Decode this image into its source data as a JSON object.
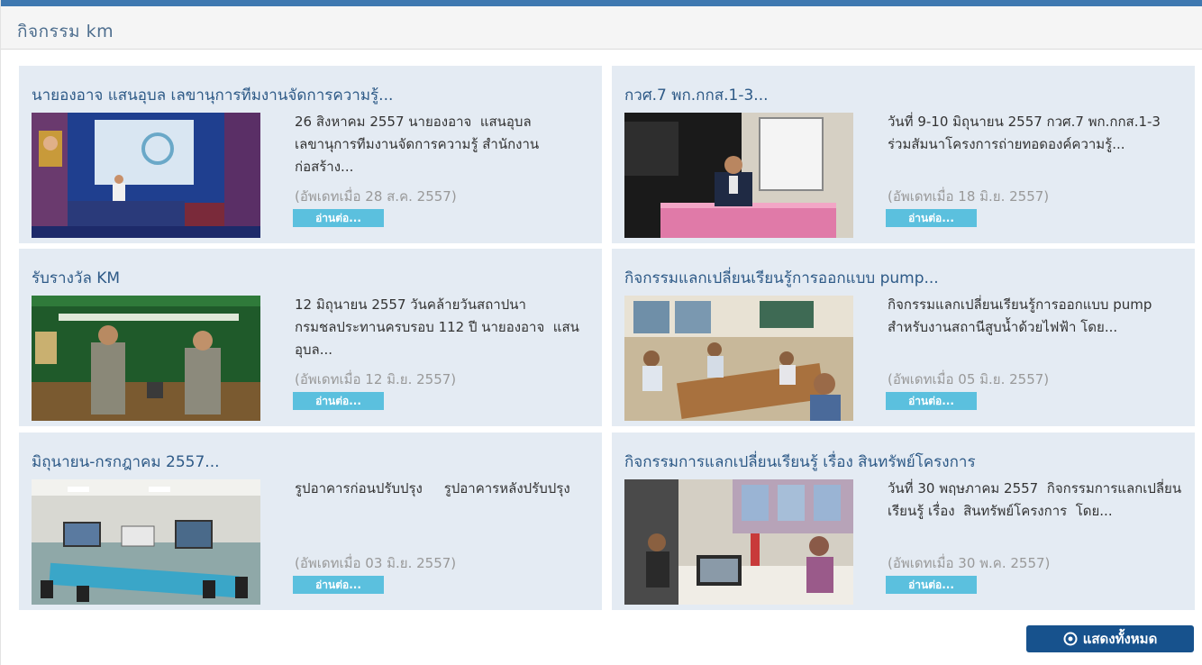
{
  "panel": {
    "title": "กิจกรรม km",
    "show_all_label": "แสดงทั้งหมด",
    "show_all_icon": "circle-play-icon"
  },
  "colors": {
    "top_bar": "#3f78b0",
    "card_bg": "#e4ebf3",
    "title_link": "#2e5a87",
    "read_more_bg": "#5bc0de",
    "show_all_bg": "#17528d"
  },
  "cards": [
    {
      "title": "นายองอาจ แสนอุบล เลขานุการทีมงานจัดการความรู้...",
      "excerpt": "26 สิงหาคม 2557 นายองอาจ  แสนอุบล เลขานุการทีมงานจัดการความรู้ สำนักงานก่อสร้าง...",
      "updated": "(อัพเดทเมื่อ 28 ส.ค. 2557)",
      "read_more": "อ่านต่อ..."
    },
    {
      "title": "กวศ.7 พก.กกส.1-3...",
      "excerpt": "วันที่ 9-10 มิถุนายน 2557 กวศ.7 พก.กกส.1-3 ร่วมสัมนาโครงการถ่ายทอดองค์ความรู้...",
      "updated": "(อัพเดทเมื่อ 18 มิ.ย. 2557)",
      "read_more": "อ่านต่อ..."
    },
    {
      "title": "รับรางวัล KM",
      "excerpt": "12 มิถุนายน 2557 วันคล้ายวันสถาปนากรมชลประทานครบรอบ 112 ปี นายองอาจ  แสนอุบล...",
      "updated": "(อัพเดทเมื่อ 12 มิ.ย. 2557)",
      "read_more": "อ่านต่อ..."
    },
    {
      "title": "กิจกรรมแลกเปลี่ยนเรียนรู้การออกแบบ pump...",
      "excerpt": "กิจกรรมแลกเปลี่ยนเรียนรู้การออกแบบ pump สำหรับงานสถานีสูบน้ำด้วยไฟฟ้า โดย...",
      "updated": "(อัพเดทเมื่อ 05 มิ.ย. 2557)",
      "read_more": "อ่านต่อ..."
    },
    {
      "title": "มิถุนายน-กรกฎาคม 2557...",
      "excerpt": "รูปอาคารก่อนปรับปรุง     รูปอาคารหลังปรับปรุง",
      "updated": "(อัพเดทเมื่อ 03 มิ.ย. 2557)",
      "read_more": "อ่านต่อ..."
    },
    {
      "title": "กิจกรรมการแลกเปลี่ยนเรียนรู้ เรื่อง สินทรัพย์โครงการ",
      "excerpt": "วันที่ 30 พฤษภาคม 2557  กิจกรรมการแลกเปลี่ยนเรียนรู้ เรื่อง  สินทรัพย์โครงการ  โดย...",
      "updated": "(อัพเดทเมื่อ 30 พ.ค. 2557)",
      "read_more": "อ่านต่อ..."
    }
  ]
}
